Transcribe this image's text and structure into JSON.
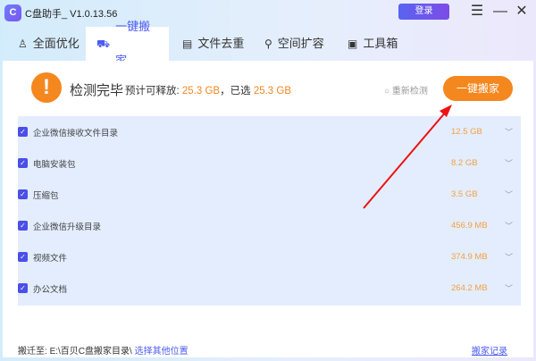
{
  "app": {
    "title": "C盘助手_ V1.0.13.56",
    "login": "登录"
  },
  "tabs": [
    {
      "label": "全面优化",
      "icon": "♙"
    },
    {
      "label": "一键搬家",
      "icon": "⛟"
    },
    {
      "label": "文件去重",
      "icon": "▤"
    },
    {
      "label": "空间扩容",
      "icon": "⚲"
    },
    {
      "label": "工具箱",
      "icon": "▣"
    }
  ],
  "status": {
    "title": "检测完毕",
    "estimate_label": "预计可释放:",
    "estimate": "25.3 GB",
    "selected_label": "，已选",
    "selected": "25.3 GB",
    "rescan": "重新检测",
    "action": "一键搬家"
  },
  "items": [
    {
      "name": "企业微信接收文件目录",
      "size": "12.5 GB",
      "checked": true
    },
    {
      "name": "电脑安装包",
      "size": "8.2 GB",
      "checked": true
    },
    {
      "name": "压缩包",
      "size": "3.5 GB",
      "checked": true
    },
    {
      "name": "企业微信升级目录",
      "size": "456.9 MB",
      "checked": true
    },
    {
      "name": "视频文件",
      "size": "374.9 MB",
      "checked": true
    },
    {
      "name": "办公文档",
      "size": "264.2 MB",
      "checked": true
    }
  ],
  "footer": {
    "label": "搬迁至:",
    "path": "E:\\百贝C盘搬家目录\\",
    "choose": "选择其他位置",
    "records": "搬家记录"
  },
  "colors": {
    "accent": "#4a5cf2",
    "orange": "#f5871f"
  }
}
